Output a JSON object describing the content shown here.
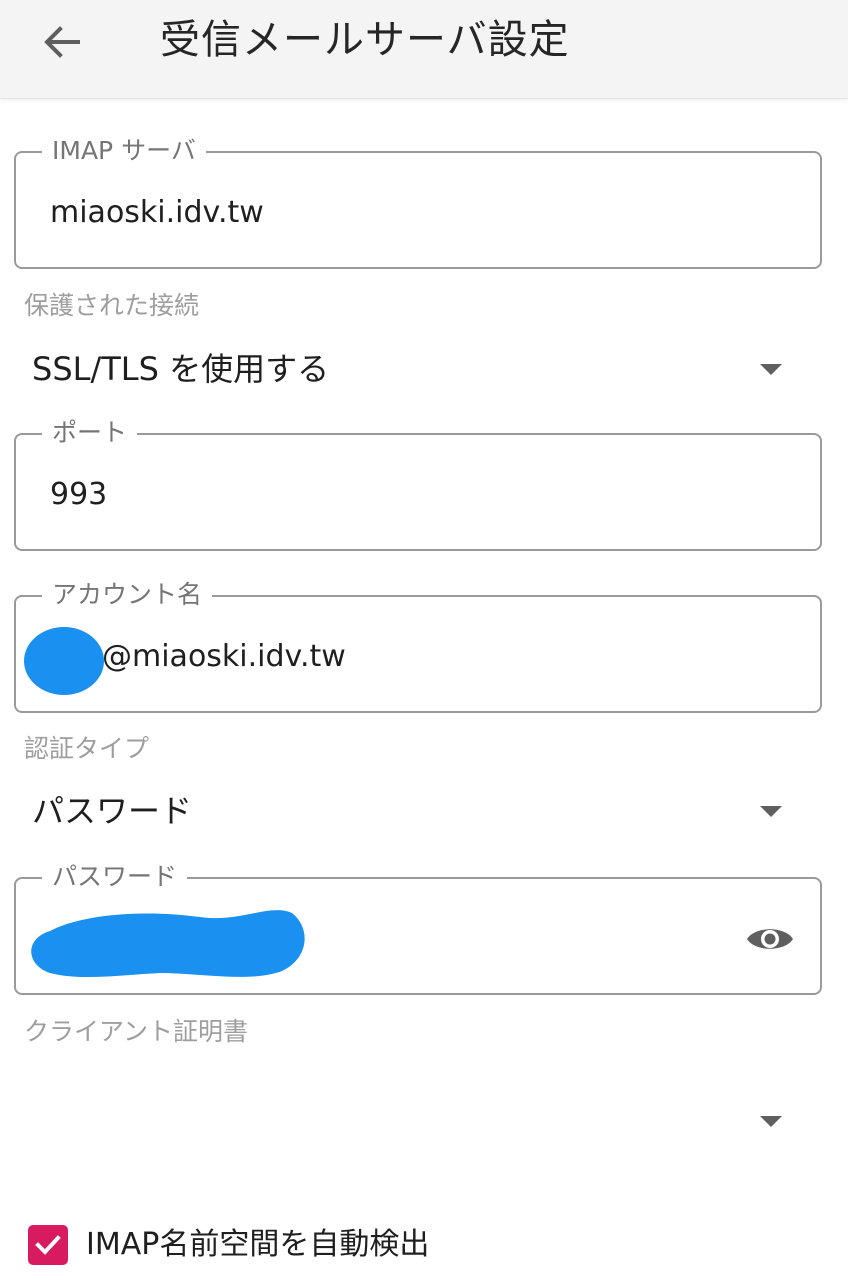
{
  "header": {
    "title": "受信メールサーバ設定",
    "back_icon": "arrow-left-icon"
  },
  "imap_server": {
    "label": "IMAP サーバ",
    "value": "miaoski.idv.tw"
  },
  "security": {
    "label": "保護された接続",
    "selected": "SSL/TLS を使用する"
  },
  "port": {
    "label": "ポート",
    "value": "993"
  },
  "account": {
    "label": "アカウント名",
    "value": "@miaoski.idv.tw",
    "redaction_color": "#1a90f0"
  },
  "auth_type": {
    "label": "認証タイプ",
    "selected": "パスワード"
  },
  "password": {
    "label": "パスワード",
    "toggle_icon": "eye-icon",
    "redaction_color": "#1a90f0"
  },
  "client_cert": {
    "label": "クライアント証明書",
    "selected": ""
  },
  "namespace_autodetect": {
    "label": "IMAP名前空間を自動検出",
    "checked": true,
    "accent_color": "#d81b60"
  }
}
